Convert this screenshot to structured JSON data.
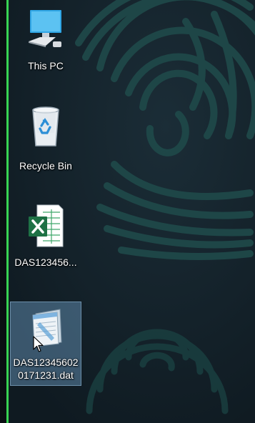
{
  "desktop": {
    "icons": [
      {
        "label": "This PC",
        "icon": "this-pc-icon"
      },
      {
        "label": "Recycle Bin",
        "icon": "recycle-bin-icon"
      },
      {
        "label": "DAS123456...",
        "icon": "excel-file-icon"
      },
      {
        "label": "DAS123456020171231.dat",
        "icon": "notepad-file-icon",
        "selected": true
      }
    ]
  },
  "colors": {
    "wallpaper": "#15232c",
    "fingerprint": "#1f4a4a",
    "left_edge": "#39d353",
    "selection": "#6ea0c8"
  }
}
